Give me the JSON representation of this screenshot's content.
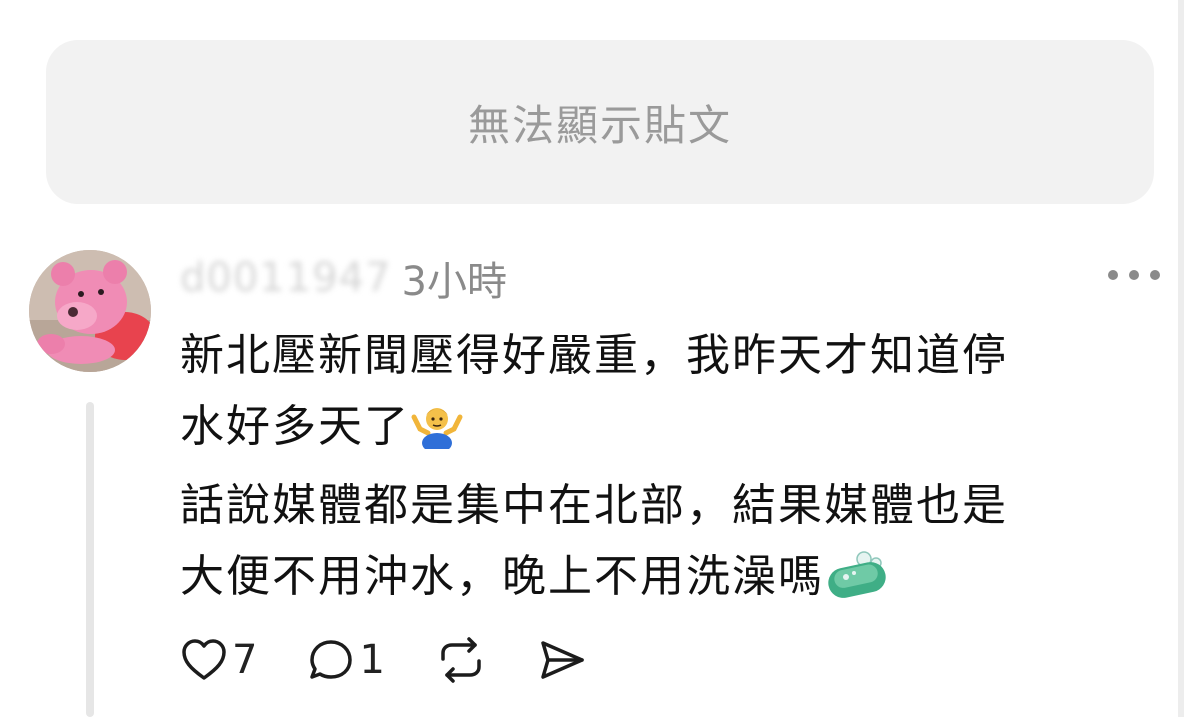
{
  "unavailable_post": {
    "message": "無法顯示貼文"
  },
  "reply": {
    "username": "d0011947",
    "timestamp": "3小時",
    "lines": [
      "新北壓新聞壓得好嚴重，我昨天才知道停",
      "水好多天了",
      "話說媒體都是集中在北部，結果媒體也是",
      "大便不用沖水，晚上不用洗澡嗎"
    ],
    "emojis": [
      "person-shrugging-emoji",
      "soap-emoji"
    ]
  },
  "actions": {
    "likes": "7",
    "replies": "1",
    "icons": [
      "heart-icon",
      "comment-icon",
      "repost-icon",
      "share-icon"
    ]
  },
  "colors": {
    "card_background": "#f2f2f2",
    "muted_text": "#8a8a8a",
    "body_text": "#111111"
  }
}
